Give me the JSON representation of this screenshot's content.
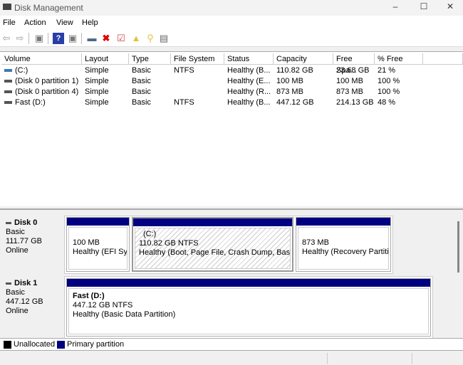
{
  "window": {
    "title": "Disk Management"
  },
  "menu": [
    "File",
    "Action",
    "View",
    "Help"
  ],
  "columns": [
    "Volume",
    "Layout",
    "Type",
    "File System",
    "Status",
    "Capacity",
    "Free Spa...",
    "% Free"
  ],
  "volumes": [
    [
      "(C:)",
      "Simple",
      "Basic",
      "NTFS",
      "Healthy (B...",
      "110.82 GB",
      "23.68 GB",
      "21 %"
    ],
    [
      "(Disk 0 partition 1)",
      "Simple",
      "Basic",
      "",
      "Healthy (E...",
      "100 MB",
      "100 MB",
      "100 %"
    ],
    [
      "(Disk 0 partition 4)",
      "Simple",
      "Basic",
      "",
      "Healthy (R...",
      "873 MB",
      "873 MB",
      "100 %"
    ],
    [
      "Fast (D:)",
      "Simple",
      "Basic",
      "NTFS",
      "Healthy (B...",
      "447.12 GB",
      "214.13 GB",
      "48 %"
    ]
  ],
  "disks": [
    {
      "name": "Disk 0",
      "type": "Basic",
      "size": "111.77 GB",
      "state": "Online",
      "partitions": [
        {
          "label": "",
          "size": "100 MB",
          "status": "Healthy (EFI Syst"
        },
        {
          "label": "(C:)",
          "size": "110.82 GB NTFS",
          "status": "Healthy (Boot, Page File, Crash Dump, Basic Da"
        },
        {
          "label": "",
          "size": "873 MB",
          "status": "Healthy (Recovery Partitio"
        }
      ]
    },
    {
      "name": "Disk 1",
      "type": "Basic",
      "size": "447.12 GB",
      "state": "Online",
      "partitions": [
        {
          "label": "Fast  (D:)",
          "size": "447.12 GB NTFS",
          "status": "Healthy (Basic Data Partition)"
        }
      ]
    }
  ],
  "legend": {
    "unallocated": "Unallocated",
    "primary": "Primary partition"
  },
  "colors": {
    "primary": "#000080",
    "unallocated": "#000000"
  }
}
